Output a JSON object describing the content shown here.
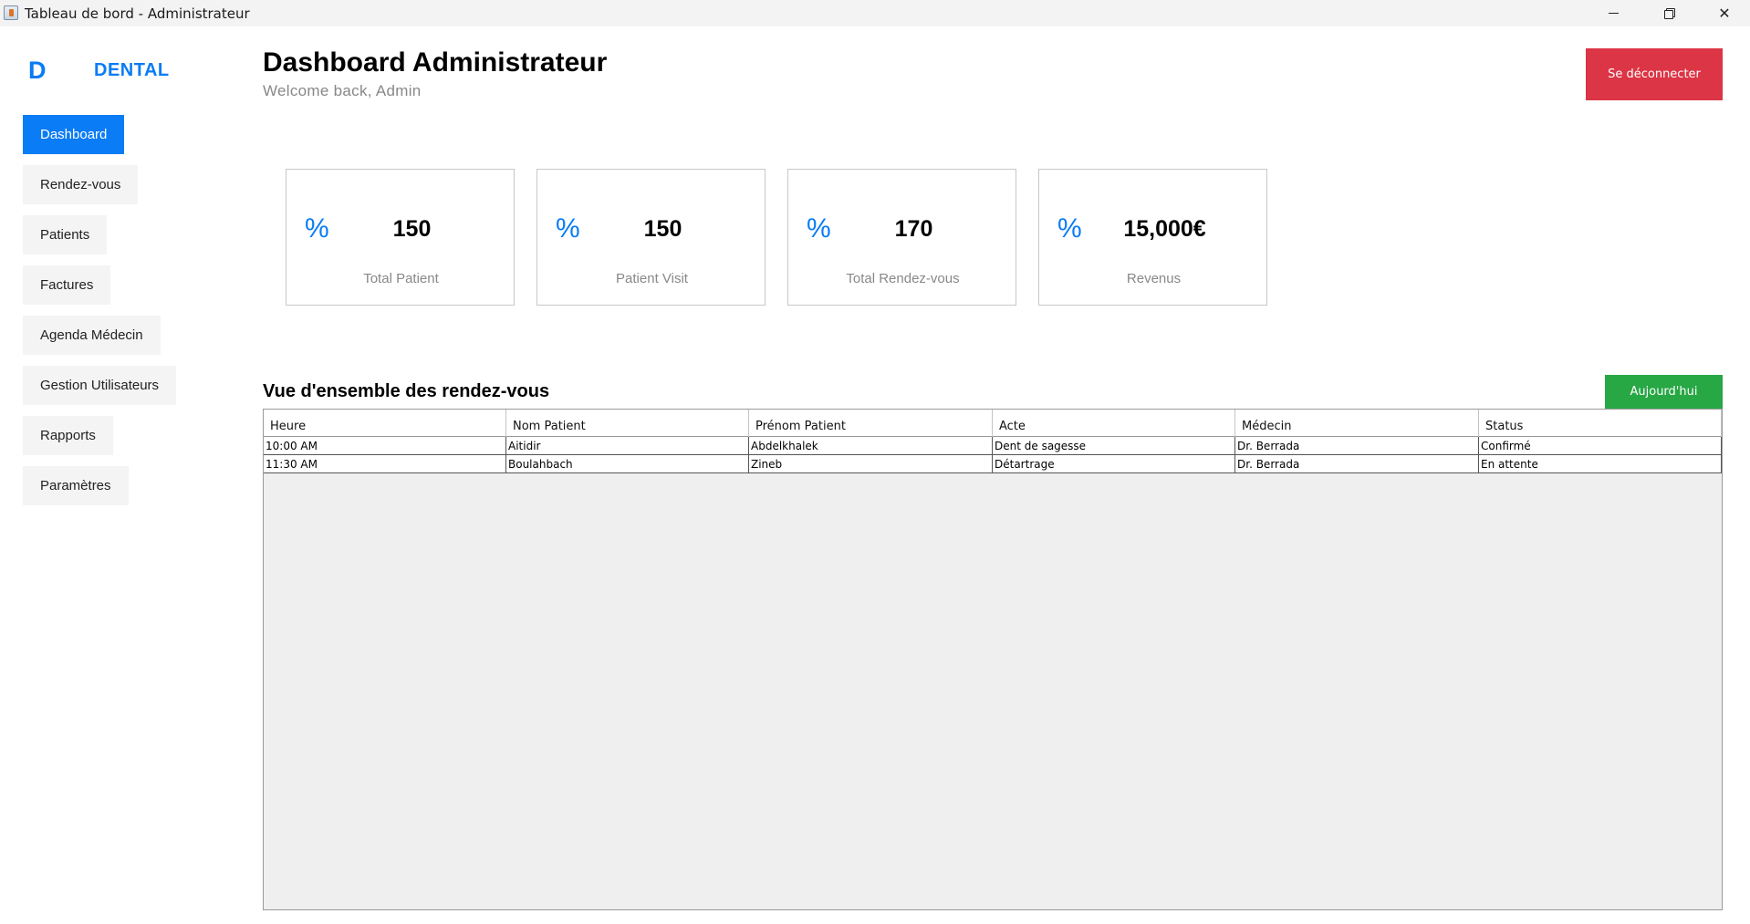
{
  "window": {
    "title": "Tableau de bord - Administrateur",
    "controls": {
      "minimize": "minimize-icon",
      "maximize": "restore-icon",
      "close": "close-icon"
    }
  },
  "brand": {
    "logo": "D",
    "name": "DENTAL"
  },
  "sidebar": {
    "items": [
      {
        "label": "Dashboard",
        "active": true
      },
      {
        "label": "Rendez-vous",
        "active": false
      },
      {
        "label": "Patients",
        "active": false
      },
      {
        "label": "Factures",
        "active": false
      },
      {
        "label": "Agenda Médecin",
        "active": false
      },
      {
        "label": "Gestion Utilisateurs",
        "active": false
      },
      {
        "label": "Rapports",
        "active": false
      },
      {
        "label": "Paramètres",
        "active": false
      }
    ]
  },
  "header": {
    "title": "Dashboard Administrateur",
    "subtitle": "Welcome back, Admin",
    "logout_label": "Se déconnecter"
  },
  "stats": [
    {
      "icon": "%",
      "value": "150",
      "label": "Total Patient"
    },
    {
      "icon": "%",
      "value": "150",
      "label": "Patient Visit"
    },
    {
      "icon": "%",
      "value": "170",
      "label": "Total Rendez-vous"
    },
    {
      "icon": "%",
      "value": "15,000€",
      "label": "Revenus"
    }
  ],
  "appointments": {
    "title": "Vue d'ensemble des rendez-vous",
    "filter_label": "Aujourd'hui",
    "columns": [
      "Heure",
      "Nom Patient",
      "Prénom Patient",
      "Acte",
      "Médecin",
      "Status"
    ],
    "rows": [
      [
        "10:00 AM",
        "Aitidir",
        "Abdelkhalek",
        "Dent de sagesse",
        "Dr. Berrada",
        "Confirmé"
      ],
      [
        "11:30 AM",
        "Boulahbach",
        "Zineb",
        "Détartrage",
        "Dr. Berrada",
        "En attente"
      ]
    ]
  },
  "colors": {
    "accent": "#0a7cf5",
    "danger": "#dc3545",
    "success": "#28a745",
    "muted_text": "#888888"
  }
}
